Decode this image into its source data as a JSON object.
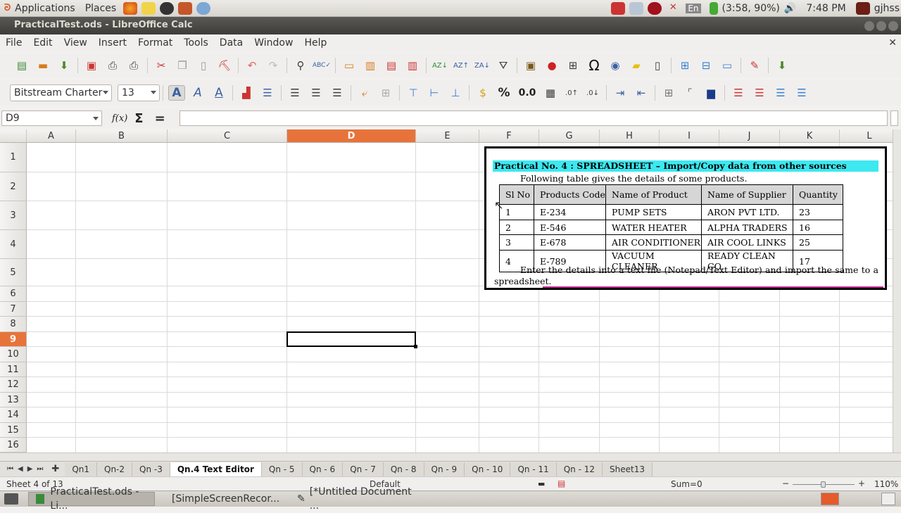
{
  "top_panel": {
    "applications": "Applications",
    "places": "Places",
    "battery": "(3:58, 90%)",
    "clock": "7:48 PM",
    "lang": "En",
    "user": "gjhss"
  },
  "window": {
    "title": "PracticalTest.ods - LibreOffice Calc"
  },
  "menubar": [
    "File",
    "Edit",
    "View",
    "Insert",
    "Format",
    "Tools",
    "Data",
    "Window",
    "Help"
  ],
  "format_toolbar": {
    "font_name": "Bitstream Charter",
    "font_size": "13",
    "percent": "%",
    "decimal": "0.0"
  },
  "formula_bar": {
    "cell_ref": "D9",
    "fx": "f(x)",
    "sigma": "Σ",
    "equals": "=",
    "content": ""
  },
  "columns": [
    "A",
    "B",
    "C",
    "D",
    "E",
    "F",
    "G",
    "H",
    "I",
    "J",
    "K",
    "L"
  ],
  "rows": [
    "1",
    "2",
    "3",
    "4",
    "5",
    "6",
    "7",
    "8",
    "9",
    "10",
    "11",
    "12",
    "13",
    "14",
    "15",
    "16"
  ],
  "image": {
    "heading": "Practical No. 4 : SPREADSHEET – Import/Copy data from other sources",
    "intro": "Following table gives the details of some products.",
    "table_headers": [
      "Sl No",
      "Products Code",
      "Name of Product",
      "Name of Supplier",
      "Quantity"
    ],
    "table_rows": [
      [
        "1",
        "E-234",
        "PUMP SETS",
        "ARON PVT LTD.",
        "23"
      ],
      [
        "2",
        "E-546",
        "WATER HEATER",
        "ALPHA TRADERS",
        "16"
      ],
      [
        "3",
        "E-678",
        "AIR CONDITIONER",
        "AIR COOL LINKS",
        "25"
      ],
      [
        "4",
        "E-789",
        "VACUUM CLEANER",
        "READY CLEAN CO.",
        "17"
      ]
    ],
    "instruction_line1": "Enter the details into a text file (Notepad/Text Editor) and import the same to a",
    "instruction_line2": "spreadsheet."
  },
  "sheet_tabs": [
    "Qn1",
    "Qn-2",
    "Qn -3",
    "Qn.4 Text Editor",
    "Qn - 5",
    "Qn - 6",
    "Qn - 7",
    "Qn - 8",
    "Qn - 9",
    "Qn - 10",
    "Qn - 11",
    "Qn - 12",
    "Sheet13"
  ],
  "status": {
    "sheet": "Sheet 4 of 13",
    "style": "Default",
    "sum": "Sum=0",
    "zoom": "110%"
  },
  "taskbar": [
    "PracticalTest.ods - Li...",
    "[SimpleScreenRecor...",
    "[*Untitled Document ..."
  ],
  "colors": {
    "accent": "#e8733a",
    "title_bg": "#3d3c38",
    "highlight_cyan": "#3de8f0"
  }
}
